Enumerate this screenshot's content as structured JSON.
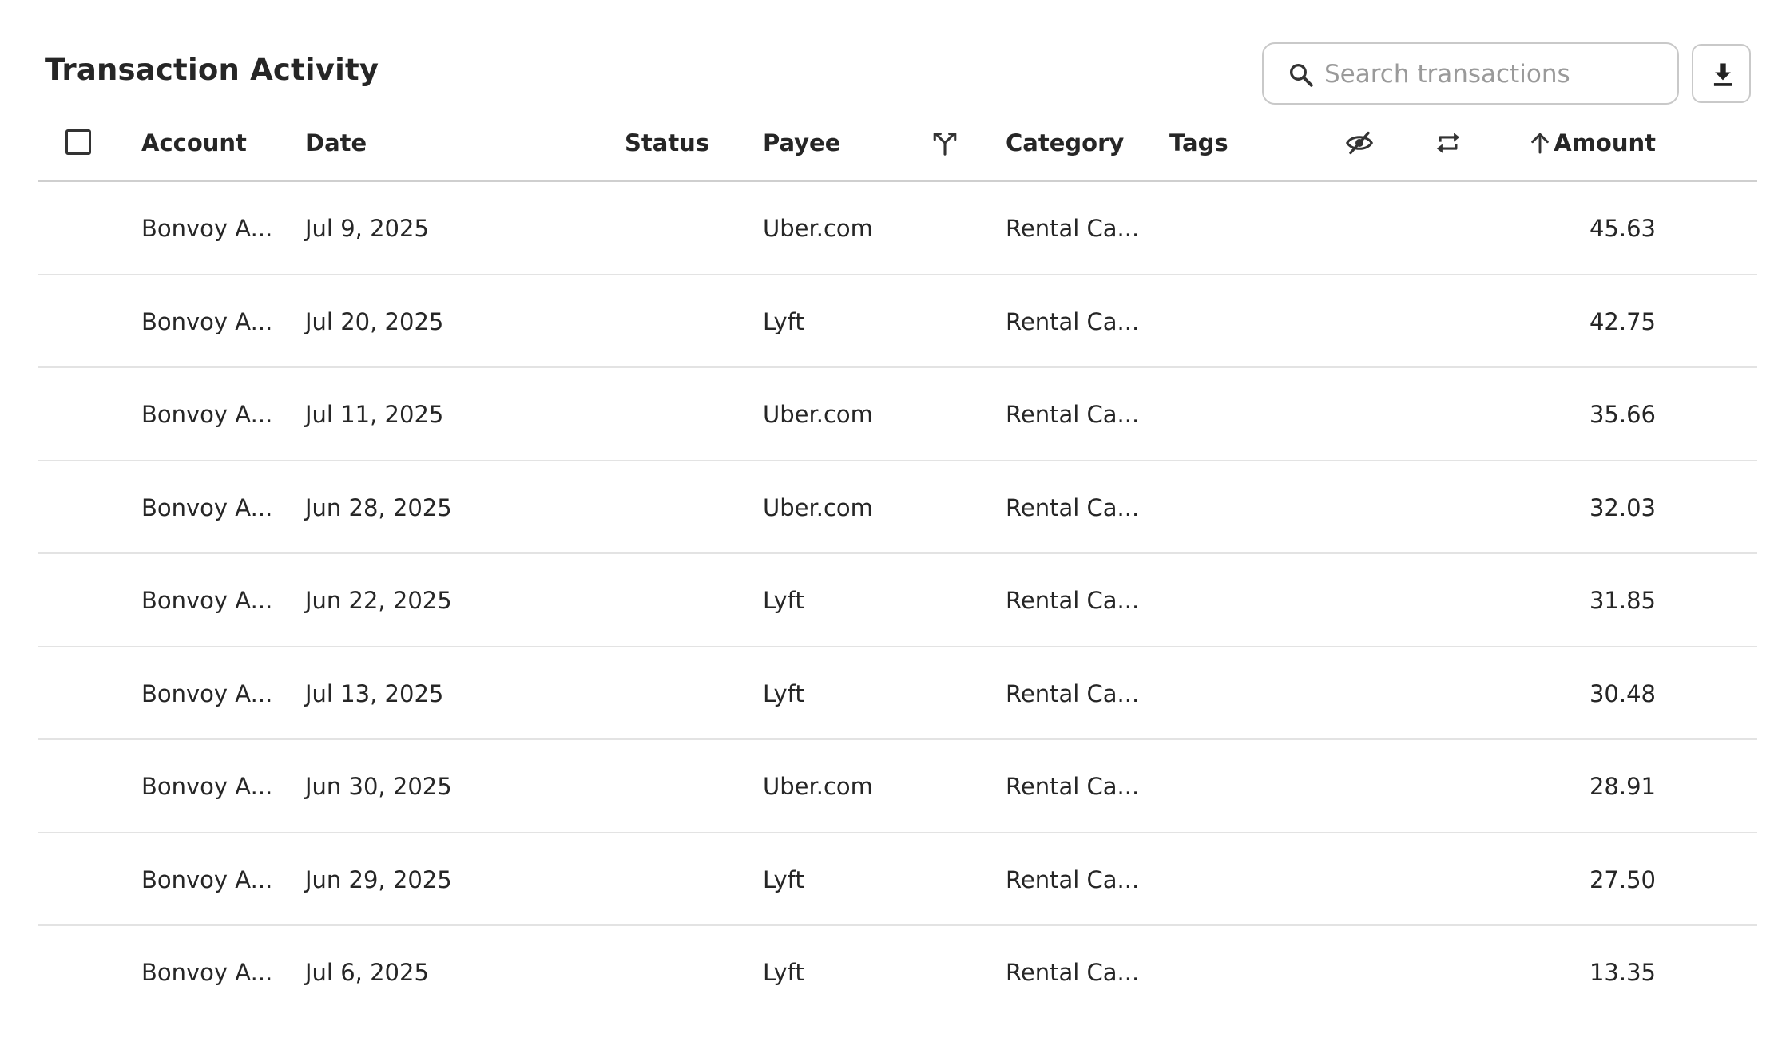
{
  "header": {
    "title": "Transaction Activity",
    "search_placeholder": "Search transactions"
  },
  "columns": {
    "account": "Account",
    "date": "Date",
    "status": "Status",
    "payee": "Payee",
    "category": "Category",
    "tags": "Tags",
    "amount": "Amount"
  },
  "icons": {
    "search": "search-icon",
    "download": "download-icon",
    "split": "split-icon",
    "hidden": "eye-off-icon",
    "recurring": "repeat-icon",
    "sort": "arrow-up-icon"
  },
  "rows": [
    {
      "account": "Bonvoy A...",
      "date": "Jul 9, 2025",
      "status": "",
      "payee": "Uber.com",
      "category": "Rental Ca...",
      "tags": "",
      "amount": "45.63"
    },
    {
      "account": "Bonvoy A...",
      "date": "Jul 20, 2025",
      "status": "",
      "payee": "Lyft",
      "category": "Rental Ca...",
      "tags": "",
      "amount": "42.75"
    },
    {
      "account": "Bonvoy A...",
      "date": "Jul 11, 2025",
      "status": "",
      "payee": "Uber.com",
      "category": "Rental Ca...",
      "tags": "",
      "amount": "35.66"
    },
    {
      "account": "Bonvoy A...",
      "date": "Jun 28, 2025",
      "status": "",
      "payee": "Uber.com",
      "category": "Rental Ca...",
      "tags": "",
      "amount": "32.03"
    },
    {
      "account": "Bonvoy A...",
      "date": "Jun 22, 2025",
      "status": "",
      "payee": "Lyft",
      "category": "Rental Ca...",
      "tags": "",
      "amount": "31.85"
    },
    {
      "account": "Bonvoy A...",
      "date": "Jul 13, 2025",
      "status": "",
      "payee": "Lyft",
      "category": "Rental Ca...",
      "tags": "",
      "amount": "30.48"
    },
    {
      "account": "Bonvoy A...",
      "date": "Jun 30, 2025",
      "status": "",
      "payee": "Uber.com",
      "category": "Rental Ca...",
      "tags": "",
      "amount": "28.91"
    },
    {
      "account": "Bonvoy A...",
      "date": "Jun 29, 2025",
      "status": "",
      "payee": "Lyft",
      "category": "Rental Ca...",
      "tags": "",
      "amount": "27.50"
    },
    {
      "account": "Bonvoy A...",
      "date": "Jul 6, 2025",
      "status": "",
      "payee": "Lyft",
      "category": "Rental Ca...",
      "tags": "",
      "amount": "13.35"
    }
  ]
}
